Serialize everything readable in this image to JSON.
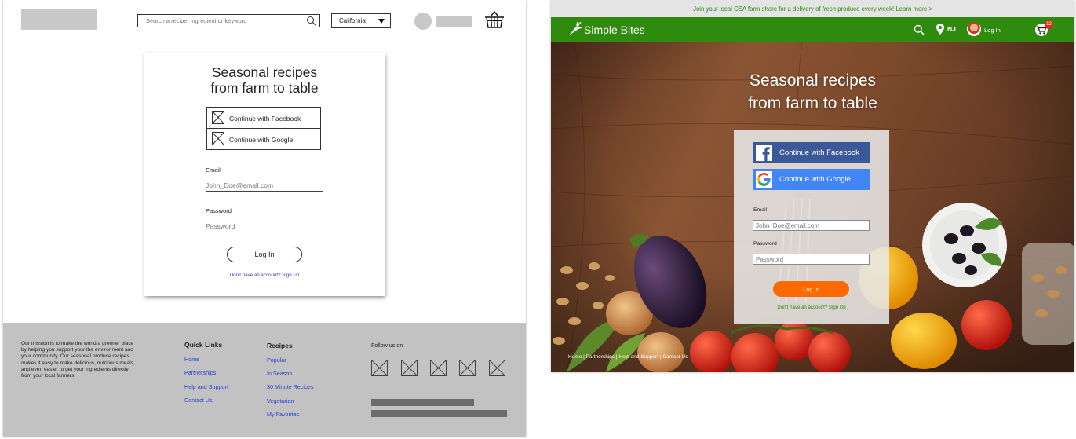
{
  "wireframe": {
    "search_placeholder": "Search a recipe, ingredient or keyword",
    "location_select": "California",
    "title_line1": "Seasonal recipes",
    "title_line2": "from farm to table",
    "facebook_label": "Continue with Facebook",
    "google_label": "Continue with Google",
    "email_label": "Email",
    "email_placeholder": "John_Doe@email.com",
    "password_label": "Password",
    "password_placeholder": "Password",
    "login_label": "Log In",
    "signup_text": "Don't have an account? Sign Up",
    "footer": {
      "mission": "Our mission is to make the world a greener place by helping you support your the environment and your community. Our seasonal produce recipes makes it easy to make delicious, nutritious meals, and even easier to get your ingredients directly from your local farmers.",
      "quick_links_heading": "Quick Links",
      "quick_links": [
        "Home",
        "Partnerships",
        "Help and Support",
        "Contact Us"
      ],
      "recipes_heading": "Recipes",
      "recipes_links": [
        "Popular",
        "In Season",
        "30 Minute Recipes",
        "Vegetarian",
        "My Favorites"
      ],
      "follow_label": "Follow us on"
    }
  },
  "mockup": {
    "promo_text": "Join your local CSA farm share for a delivery of fresh produce every week!  Learn more >",
    "brand_name": "Simple Bites",
    "location": "NJ",
    "login_link": "Log In",
    "cart_count": "12",
    "title_line1": "Seasonal recipes",
    "title_line2": "from farm to table",
    "facebook_label": "Continue with Facebook",
    "google_label": "Continue with Google",
    "email_label": "Email",
    "email_placeholder": "John_Doe@email.com",
    "password_label": "Password",
    "password_placeholder": "Password",
    "login_label": "Log In",
    "signup_text": "Don't have an account? Sign Up",
    "footer_links": "Home | Partnerships | Help and Support | Contact Us",
    "colors": {
      "brand_green": "#2f8b0e",
      "login_orange": "#ff6a00",
      "facebook_blue": "#3b5998",
      "google_blue": "#4285f4",
      "badge_red": "#e8261b"
    }
  }
}
